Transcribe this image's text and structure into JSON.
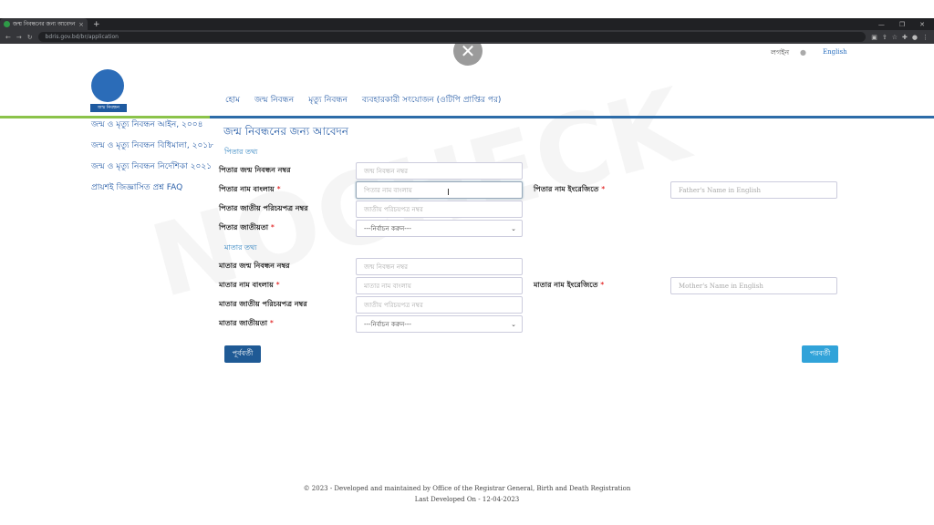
{
  "browser": {
    "tab_title": "জন্ম নিবন্ধনের জন্য আবেদন",
    "tab_close": "×",
    "new_tab": "+",
    "url": "bdris.gov.bd/br/application",
    "window_controls": [
      "—",
      "❐",
      "✕"
    ]
  },
  "header": {
    "close_symbol": "✕",
    "login": "লগইন",
    "language": "English",
    "logo_text": "জন্ম নিবন্ধন",
    "nav": [
      "হোম",
      "জন্ম নিবন্ধন",
      "মৃত্যু নিবন্ধন",
      "ব্যবহারকারী সংযোজন (ওটিপি প্রাপ্তির পর)"
    ]
  },
  "sidebar": {
    "items": [
      "জন্ম ও মৃত্যু নিবন্ধন আইন, ২০০৪",
      "জন্ম ও মৃত্যু নিবন্ধন বিধিমালা, ২০১৮",
      "জন্ম ও মৃত্যু নিবন্ধন নির্দেশিকা ২০২১",
      "প্রায়শই জিজ্ঞাসিত প্রশ্ন FAQ"
    ]
  },
  "form": {
    "title": "জন্ম নিবন্ধনের জন্য আবেদন",
    "father_section": "পিতার তথ্য",
    "mother_section": "মাতার তথ্য",
    "required_mark": "*",
    "father": {
      "brn_label": "পিতার জন্ম নিবন্ধন নম্বর",
      "brn_placeholder": "জন্ম নিবন্ধন নম্বর",
      "name_bn_label": "পিতার নাম বাংলায়",
      "name_bn_placeholder": "পিতার নাম বাংলায়",
      "name_en_label": "পিতার নাম ইংরেজিতে",
      "name_en_placeholder": "Father's Name in English",
      "nid_label": "পিতার জাতীয় পরিচয়পত্র নম্বর",
      "nid_placeholder": "জাতীয় পরিচয়পত্র নম্বর",
      "nationality_label": "পিতার জাতীয়তা",
      "nationality_value": "---নির্বাচন করুন---"
    },
    "mother": {
      "brn_label": "মাতার জন্ম নিবন্ধন নম্বর",
      "brn_placeholder": "জন্ম নিবন্ধন নম্বর",
      "name_bn_label": "মাতার নাম বাংলায়",
      "name_bn_placeholder": "মাতার নাম বাংলায়",
      "name_en_label": "মাতার নাম ইংরেজিতে",
      "name_en_placeholder": "Mother's Name in English",
      "nid_label": "মাতার জাতীয় পরিচয়পত্র নম্বর",
      "nid_placeholder": "জাতীয় পরিচয়পত্র নম্বর",
      "nationality_label": "মাতার জাতীয়তা",
      "nationality_value": "---নির্বাচন করুন---"
    },
    "prev_button": "পূর্ববর্তী",
    "next_button": "পরবর্তী"
  },
  "footer": {
    "line1": "© 2023 - Developed and maintained by Office of the Registrar General, Birth and Death Registration",
    "line2": "Last Developed On - 12-04-2023"
  },
  "colors": {
    "nav_blue": "#2a5fa8",
    "prev_button": "#1f5a95",
    "next_button": "#31a3d9",
    "required": "#dd0000"
  }
}
